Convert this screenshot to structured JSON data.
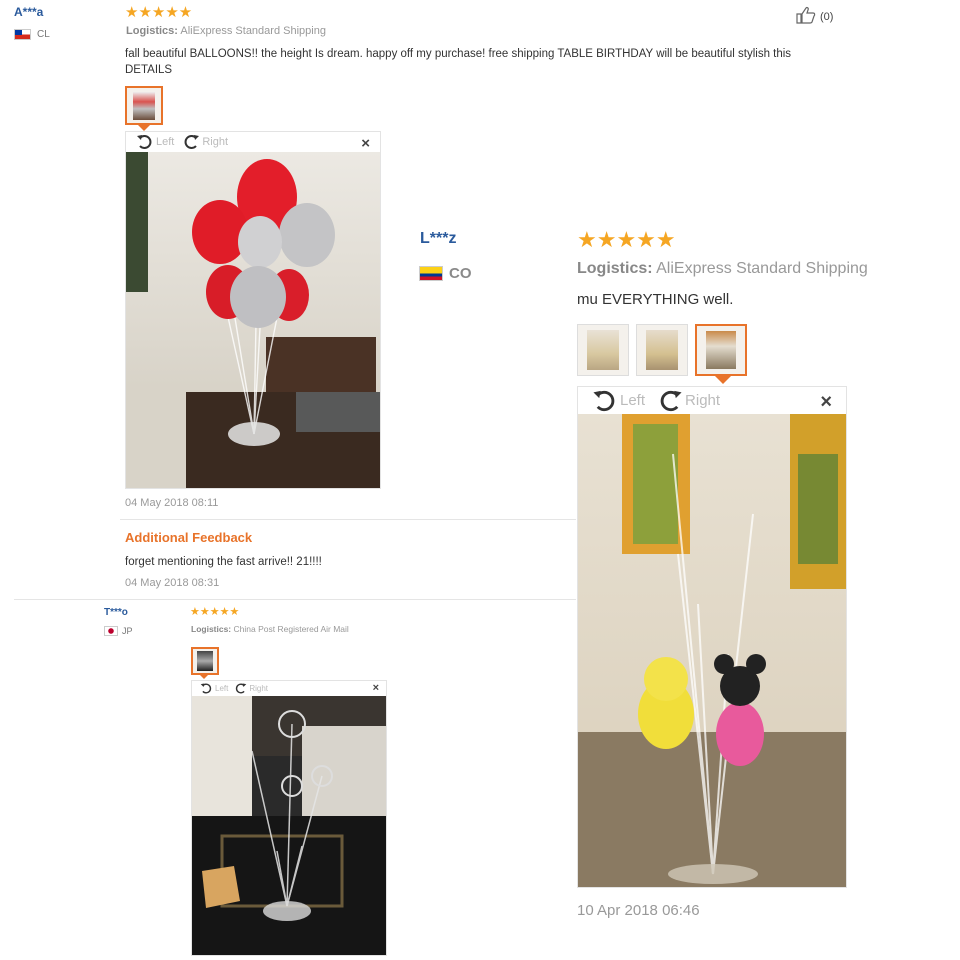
{
  "review1": {
    "user": "A***a",
    "country": "CL",
    "stars": "★★★★★",
    "logistics_label": "Logistics:",
    "logistics_value": "AliExpress Standard Shipping",
    "feedback": "fall beautiful BALLOONS!! the height Is dream. happy off my purchase! free shipping TABLE BIRTHDAY will be beautiful stylish this DETAILS",
    "likes": "(0)",
    "viewer": {
      "rotate_left": "Left",
      "rotate_right": "Right",
      "close": "×"
    },
    "date": "04 May 2018 08:11",
    "additional_title": "Additional Feedback",
    "additional_text": "forget mentioning the fast arrive!! 21!!!!",
    "additional_date": "04 May 2018 08:31"
  },
  "review2": {
    "user": "L***z",
    "country": "CO",
    "stars": "★★★★★",
    "logistics_label": "Logistics:",
    "logistics_value": "AliExpress Standard Shipping",
    "feedback": "mu EVERYTHING well.",
    "viewer": {
      "rotate_left": "Left",
      "rotate_right": "Right",
      "close": "×"
    },
    "date": "10 Apr 2018 06:46"
  },
  "review3": {
    "user": "T***o",
    "country": "JP",
    "stars": "★★★★★",
    "logistics_label": "Logistics:",
    "logistics_value": "China Post Registered Air Mail",
    "viewer": {
      "rotate_left": "Left",
      "rotate_right": "Right",
      "close": "×"
    }
  },
  "colors": {
    "accent": "#e8732a",
    "star": "#f5a623",
    "username": "#2a5a9c",
    "muted": "#999999"
  },
  "icons": [
    "thumbs-up-icon",
    "rotate-left-icon",
    "rotate-right-icon",
    "close-icon",
    "flag-icon"
  ]
}
